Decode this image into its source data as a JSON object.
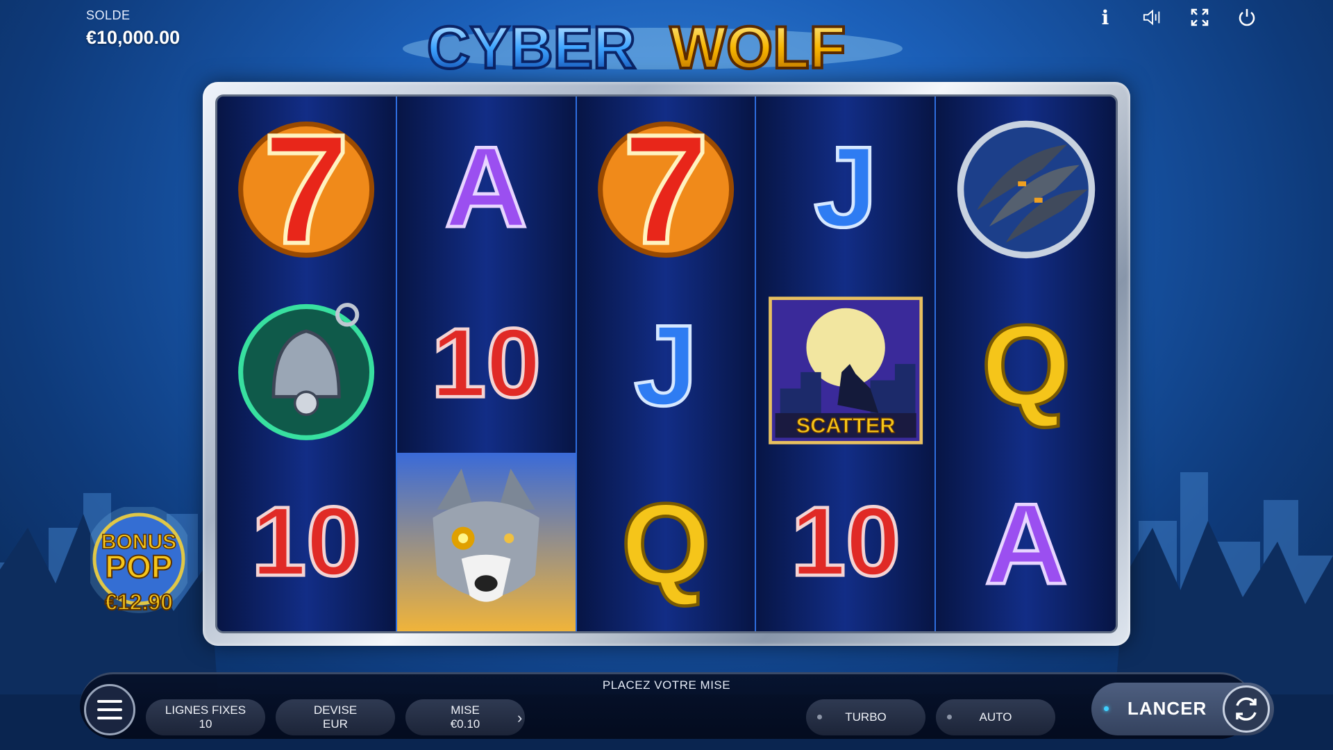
{
  "balance": {
    "label": "SOLDE",
    "value": "€10,000.00"
  },
  "logo": {
    "text_left": "CYBER",
    "text_right": "WOLF"
  },
  "top_icons": [
    "info-icon",
    "sound-icon",
    "fullscreen-icon",
    "power-icon"
  ],
  "info_glyph": "i",
  "reels": [
    [
      "seven",
      "bell",
      "ten"
    ],
    [
      "ace",
      "ten",
      "wolf"
    ],
    [
      "seven",
      "jack",
      "queen"
    ],
    [
      "jack",
      "scatter",
      "ten"
    ],
    [
      "claw",
      "queen",
      "ace"
    ]
  ],
  "symbol_text": {
    "seven": "7",
    "ace": "A",
    "jack": "J",
    "queen": "Q",
    "ten": "10",
    "scatter": "SCATTER"
  },
  "bonus_pop": {
    "line1": "BONUS",
    "line2": "POP",
    "amount": "€12.90"
  },
  "bottom_bar": {
    "title": "PLACEZ VOTRE MISE",
    "lines": {
      "label": "LIGNES FIXES",
      "value": "10"
    },
    "currency": {
      "label": "DEVISE",
      "value": "EUR"
    },
    "bet": {
      "label": "MISE",
      "value": "€0.10"
    },
    "turbo": "TURBO",
    "auto": "AUTO",
    "spin": "LANCER",
    "chevron": "›"
  },
  "colors": {
    "reel_bg": "#0a1d5a",
    "reel_divider": "#2f6fe0",
    "seven_red": "#e8261a",
    "ace_purple": "#9b4ff0",
    "jack_blue": "#2e7cf2",
    "queen_gold": "#f5c51a",
    "ten_red": "#e02a26"
  }
}
